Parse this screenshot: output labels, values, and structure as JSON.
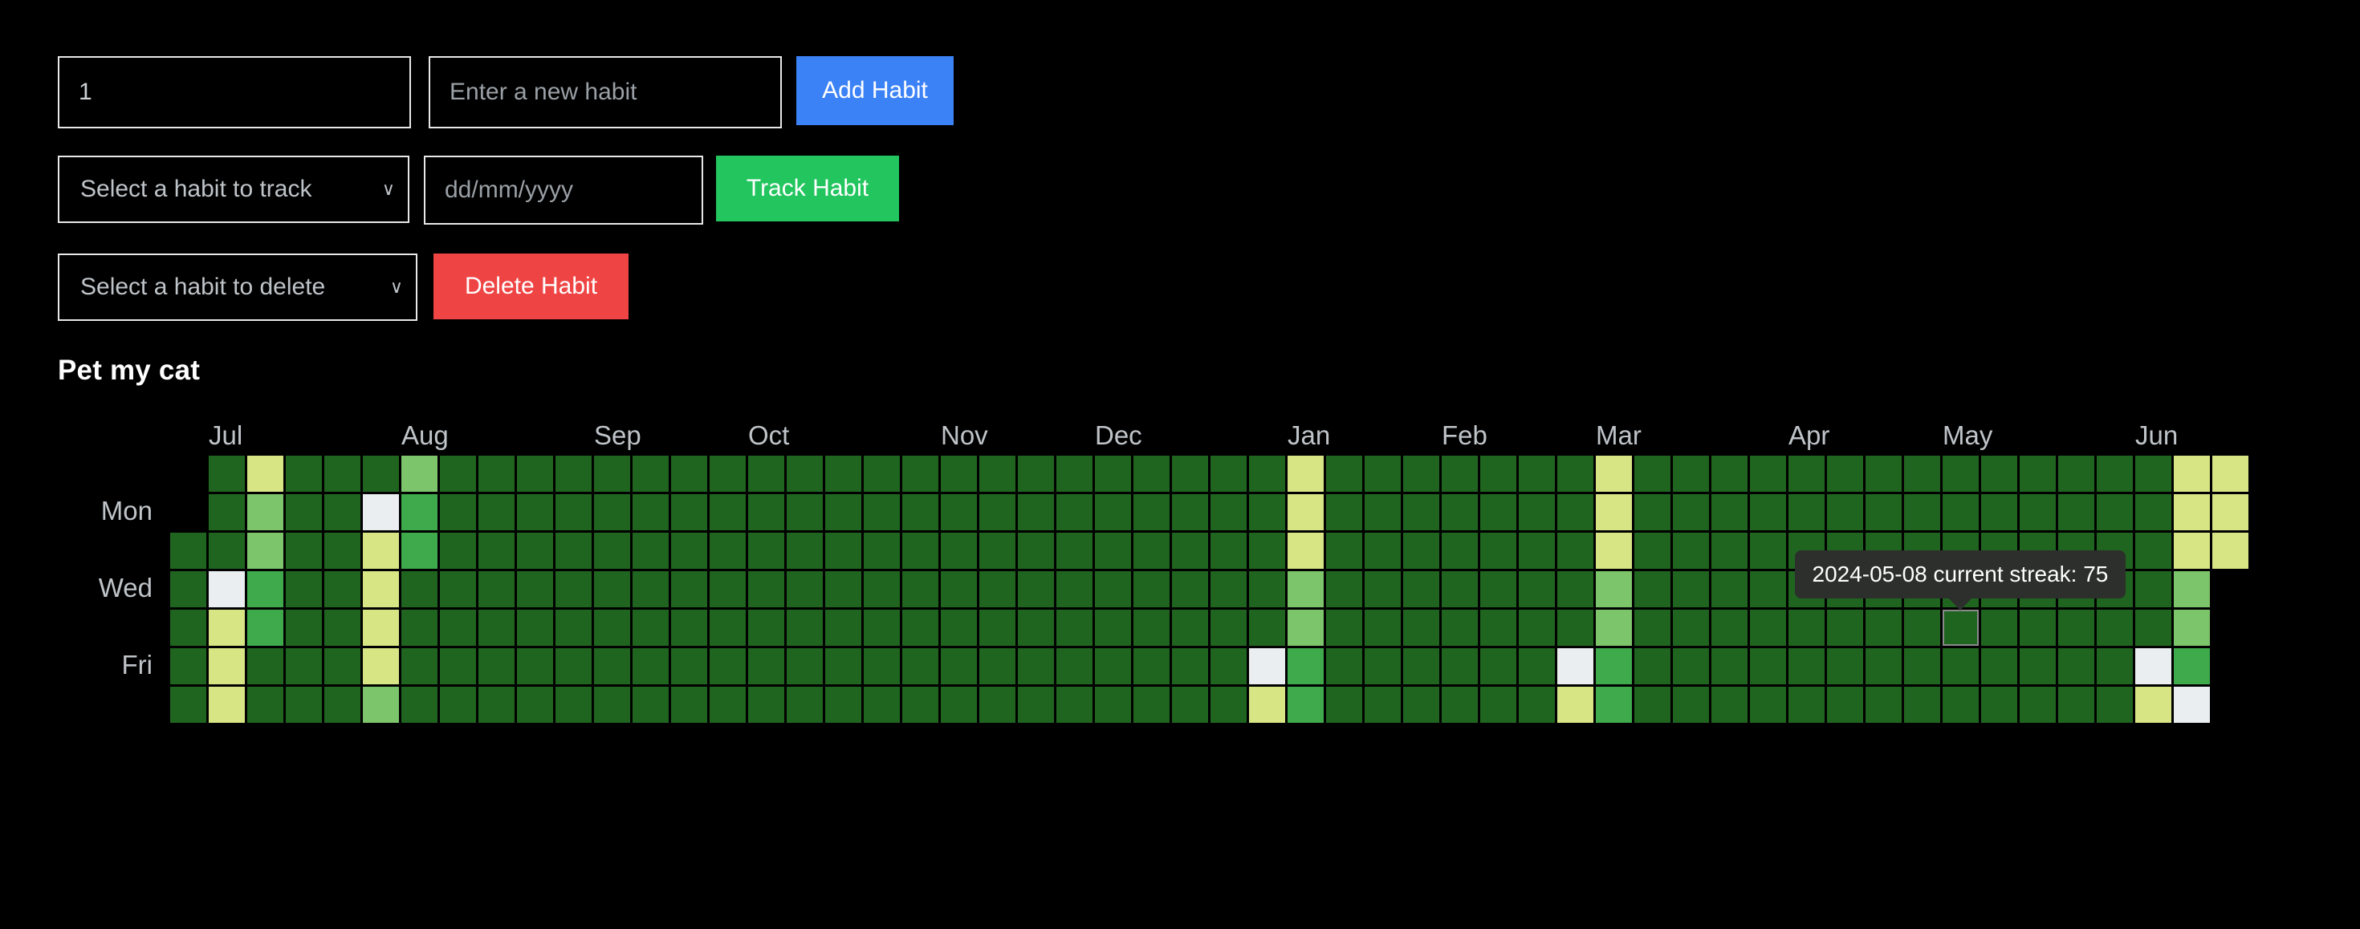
{
  "form": {
    "count_value": "1",
    "count_placeholder": "",
    "habit_placeholder": "Enter a new habit",
    "habit_value": "",
    "add_label": "Add Habit",
    "track_select_label": "Select a habit to track",
    "date_placeholder": "dd/mm/yyyy",
    "date_value": "",
    "track_label": "Track Habit",
    "delete_select_label": "Select a habit to delete",
    "delete_label": "Delete Habit",
    "chevron": "∨"
  },
  "habit": {
    "title": "Pet my cat"
  },
  "tooltip": {
    "text": "2024-05-08 current streak: 75"
  },
  "colors": {
    "add_button": "#3b82f6",
    "track_button": "#22c55e",
    "delete_button": "#ef4444",
    "level_white": "#ebeef0",
    "level_pale": "#d7e585",
    "level_light": "#7dc56b",
    "level_mid": "#3eaa4b",
    "level_dark": "#20651f",
    "background": "#000000"
  },
  "chart_data": {
    "type": "heatmap",
    "title": "Pet my cat",
    "xlabel": "",
    "ylabel": "",
    "grid": true,
    "legend_position": "none",
    "month_labels": [
      "Jul",
      "Aug",
      "Sep",
      "Oct",
      "Nov",
      "Dec",
      "Jan",
      "Feb",
      "Mar",
      "Apr",
      "May",
      "Jun"
    ],
    "month_col_index": [
      1,
      6,
      11,
      15,
      20,
      24,
      29,
      33,
      37,
      42,
      46,
      51
    ],
    "day_labels": [
      "Mon",
      "Wed",
      "Fri"
    ],
    "day_label_rows": [
      1,
      3,
      5
    ],
    "rows": 7,
    "cols": 54,
    "levels": [
      "white",
      "pale",
      "light",
      "mid",
      "dark"
    ],
    "level_colors": {
      "white": "#ebeef0",
      "pale": "#d7e585",
      "light": "#7dc56b",
      "mid": "#3eaa4b",
      "dark": "#20651f",
      "empty": "none"
    },
    "selected_cell": {
      "col": 46,
      "row": 4,
      "label": "2024-05-08",
      "current_streak": 75
    },
    "columns": [
      [
        "empty",
        "empty",
        "dark",
        "dark",
        "dark",
        "dark",
        "dark"
      ],
      [
        "dark",
        "dark",
        "dark",
        "white",
        "pale",
        "pale",
        "pale"
      ],
      [
        "pale",
        "light",
        "light",
        "mid",
        "mid",
        "dark",
        "dark"
      ],
      [
        "dark",
        "dark",
        "dark",
        "dark",
        "dark",
        "dark",
        "dark"
      ],
      [
        "dark",
        "dark",
        "dark",
        "dark",
        "dark",
        "dark",
        "dark"
      ],
      [
        "dark",
        "white",
        "pale",
        "pale",
        "pale",
        "pale",
        "light"
      ],
      [
        "light",
        "mid",
        "mid",
        "dark",
        "dark",
        "dark",
        "dark"
      ],
      [
        "dark",
        "dark",
        "dark",
        "dark",
        "dark",
        "dark",
        "dark"
      ],
      [
        "dark",
        "dark",
        "dark",
        "dark",
        "dark",
        "dark",
        "dark"
      ],
      [
        "dark",
        "dark",
        "dark",
        "dark",
        "dark",
        "dark",
        "dark"
      ],
      [
        "dark",
        "dark",
        "dark",
        "dark",
        "dark",
        "dark",
        "dark"
      ],
      [
        "dark",
        "dark",
        "dark",
        "dark",
        "dark",
        "dark",
        "dark"
      ],
      [
        "dark",
        "dark",
        "dark",
        "dark",
        "dark",
        "dark",
        "dark"
      ],
      [
        "dark",
        "dark",
        "dark",
        "dark",
        "dark",
        "dark",
        "dark"
      ],
      [
        "dark",
        "dark",
        "dark",
        "dark",
        "dark",
        "dark",
        "dark"
      ],
      [
        "dark",
        "dark",
        "dark",
        "dark",
        "dark",
        "dark",
        "dark"
      ],
      [
        "dark",
        "dark",
        "dark",
        "dark",
        "dark",
        "dark",
        "dark"
      ],
      [
        "dark",
        "dark",
        "dark",
        "dark",
        "dark",
        "dark",
        "dark"
      ],
      [
        "dark",
        "dark",
        "dark",
        "dark",
        "dark",
        "dark",
        "dark"
      ],
      [
        "dark",
        "dark",
        "dark",
        "dark",
        "dark",
        "dark",
        "dark"
      ],
      [
        "dark",
        "dark",
        "dark",
        "dark",
        "dark",
        "dark",
        "dark"
      ],
      [
        "dark",
        "dark",
        "dark",
        "dark",
        "dark",
        "dark",
        "dark"
      ],
      [
        "dark",
        "dark",
        "dark",
        "dark",
        "dark",
        "dark",
        "dark"
      ],
      [
        "dark",
        "dark",
        "dark",
        "dark",
        "dark",
        "dark",
        "dark"
      ],
      [
        "dark",
        "dark",
        "dark",
        "dark",
        "dark",
        "dark",
        "dark"
      ],
      [
        "dark",
        "dark",
        "dark",
        "dark",
        "dark",
        "dark",
        "dark"
      ],
      [
        "dark",
        "dark",
        "dark",
        "dark",
        "dark",
        "dark",
        "dark"
      ],
      [
        "dark",
        "dark",
        "dark",
        "dark",
        "dark",
        "dark",
        "dark"
      ],
      [
        "dark",
        "dark",
        "dark",
        "dark",
        "dark",
        "white",
        "pale"
      ],
      [
        "pale",
        "pale",
        "pale",
        "light",
        "light",
        "mid",
        "mid"
      ],
      [
        "dark",
        "dark",
        "dark",
        "dark",
        "dark",
        "dark",
        "dark"
      ],
      [
        "dark",
        "dark",
        "dark",
        "dark",
        "dark",
        "dark",
        "dark"
      ],
      [
        "dark",
        "dark",
        "dark",
        "dark",
        "dark",
        "dark",
        "dark"
      ],
      [
        "dark",
        "dark",
        "dark",
        "dark",
        "dark",
        "dark",
        "dark"
      ],
      [
        "dark",
        "dark",
        "dark",
        "dark",
        "dark",
        "dark",
        "dark"
      ],
      [
        "dark",
        "dark",
        "dark",
        "dark",
        "dark",
        "dark",
        "dark"
      ],
      [
        "dark",
        "dark",
        "dark",
        "dark",
        "dark",
        "white",
        "pale"
      ],
      [
        "pale",
        "pale",
        "pale",
        "light",
        "light",
        "mid",
        "mid"
      ],
      [
        "dark",
        "dark",
        "dark",
        "dark",
        "dark",
        "dark",
        "dark"
      ],
      [
        "dark",
        "dark",
        "dark",
        "dark",
        "dark",
        "dark",
        "dark"
      ],
      [
        "dark",
        "dark",
        "dark",
        "dark",
        "dark",
        "dark",
        "dark"
      ],
      [
        "dark",
        "dark",
        "dark",
        "dark",
        "dark",
        "dark",
        "dark"
      ],
      [
        "dark",
        "dark",
        "dark",
        "dark",
        "dark",
        "dark",
        "dark"
      ],
      [
        "dark",
        "dark",
        "dark",
        "dark",
        "dark",
        "dark",
        "dark"
      ],
      [
        "dark",
        "dark",
        "dark",
        "dark",
        "dark",
        "dark",
        "dark"
      ],
      [
        "dark",
        "dark",
        "dark",
        "dark",
        "dark",
        "dark",
        "dark"
      ],
      [
        "dark",
        "dark",
        "dark",
        "dark",
        "dark",
        "dark",
        "dark"
      ],
      [
        "dark",
        "dark",
        "dark",
        "dark",
        "dark",
        "dark",
        "dark"
      ],
      [
        "dark",
        "dark",
        "dark",
        "dark",
        "dark",
        "dark",
        "dark"
      ],
      [
        "dark",
        "dark",
        "dark",
        "dark",
        "dark",
        "dark",
        "dark"
      ],
      [
        "dark",
        "dark",
        "dark",
        "dark",
        "dark",
        "dark",
        "dark"
      ],
      [
        "dark",
        "dark",
        "dark",
        "dark",
        "dark",
        "white",
        "pale"
      ],
      [
        "pale",
        "pale",
        "pale",
        "light",
        "light",
        "mid",
        "white"
      ],
      [
        "pale",
        "pale",
        "pale",
        "empty",
        "empty",
        "empty",
        "empty"
      ]
    ]
  }
}
